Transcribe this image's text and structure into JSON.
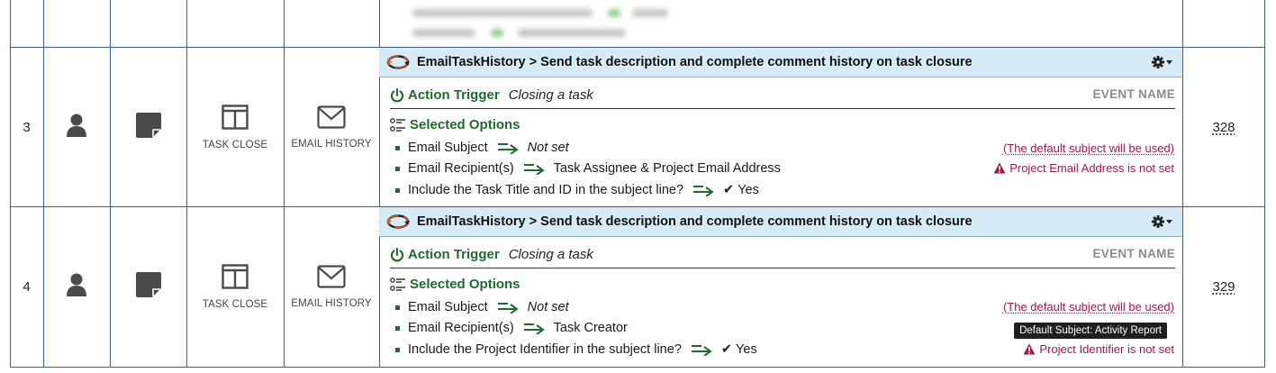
{
  "rows": [
    {
      "number": "3",
      "trigger_type": "TASK CLOSE",
      "action_type": "EMAIL HISTORY",
      "title": "EmailTaskHistory > Send task description and complete comment history on task closure",
      "trigger_label": "Action Trigger",
      "trigger_value": "Closing a task",
      "event_name": "EVENT NAME",
      "options_label": "Selected Options",
      "options": [
        {
          "label": "Email Subject",
          "value": "Not set",
          "italic": true,
          "checked": false,
          "note": "(The default subject will be used)"
        },
        {
          "label": "Email Recipient(s)",
          "value": "Task Assignee & Project Email Address",
          "italic": false,
          "checked": false,
          "note": "Project Email Address is not set"
        },
        {
          "label": "Include the Task Title and ID in the subject line?",
          "value": "Yes",
          "italic": false,
          "checked": true,
          "note": ""
        }
      ],
      "link": "328"
    },
    {
      "number": "4",
      "trigger_type": "TASK CLOSE",
      "action_type": "EMAIL HISTORY",
      "title": "EmailTaskHistory > Send task description and complete comment history on task closure",
      "trigger_label": "Action Trigger",
      "trigger_value": "Closing a task",
      "event_name": "EVENT NAME",
      "options_label": "Selected Options",
      "options": [
        {
          "label": "Email Subject",
          "value": "Not set",
          "italic": true,
          "checked": false,
          "note": "(The default subject will be used)"
        },
        {
          "label": "Email Recipient(s)",
          "value": "Task Creator",
          "italic": false,
          "checked": false,
          "note": ""
        },
        {
          "label": "Include the Project Identifier in the subject line?",
          "value": "Yes",
          "italic": false,
          "checked": true,
          "note": "Project Identifier is not set"
        }
      ],
      "tooltip": "Default Subject: Activity Report",
      "link": "329"
    }
  ],
  "icons": {
    "user": "user-icon",
    "note": "note-icon",
    "trigger": "columns-icon",
    "action": "envelope-icon",
    "title": "refresh-icon",
    "gear": "gear-icon",
    "power": "power-icon",
    "options": "checklist-icon",
    "arrow": "arrow-right-icon",
    "warning": "warning-icon"
  },
  "colors": {
    "border": "#3e5f7f",
    "title_bg": "#d7ebf6",
    "green": "#1d6b2d",
    "warning": "#a8174a",
    "muted": "#8c8c8c"
  }
}
